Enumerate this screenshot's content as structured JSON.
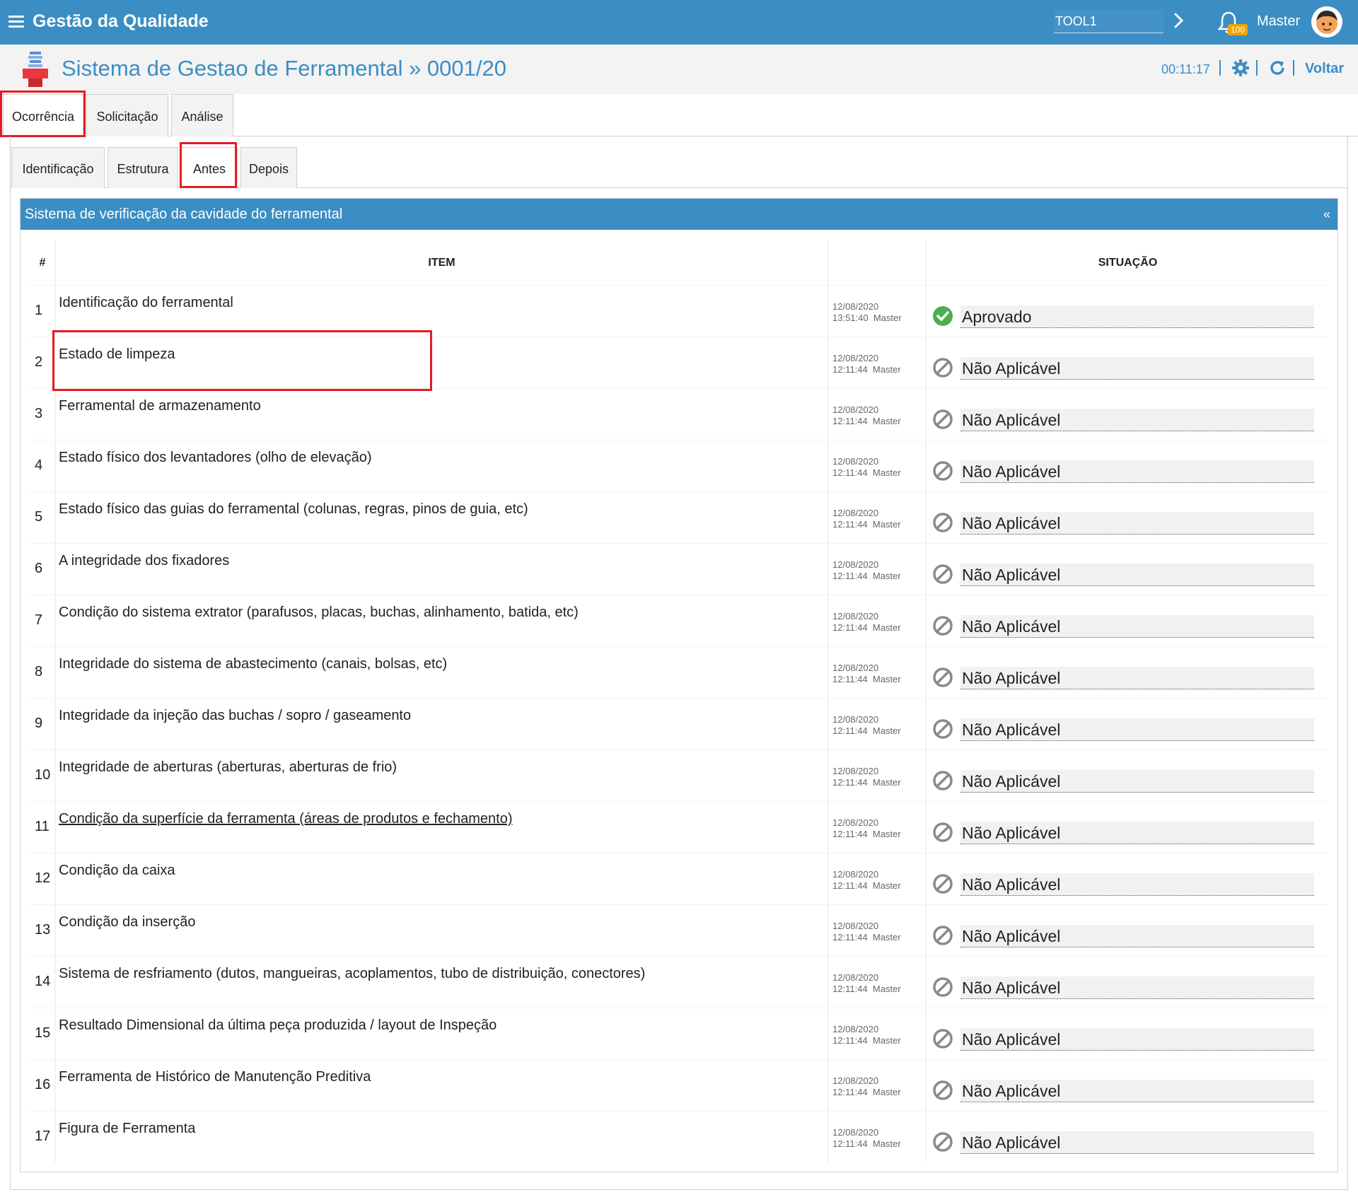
{
  "header": {
    "app_title": "Gestão da Qualidade",
    "tool_value": "TOOL1",
    "notification_count": "100",
    "user_name": "Master"
  },
  "subheader": {
    "page_title": "Sistema de Gestao de Ferramental » 0001/20",
    "timer": "00:11:17",
    "voltar": "Voltar"
  },
  "tabs": [
    "Ocorrência",
    "Solicitação",
    "Análise"
  ],
  "subtabs": [
    "Identificação",
    "Estrutura",
    "Antes",
    "Depois"
  ],
  "panel": {
    "title": "Sistema de verificação da cavidade do ferramental",
    "collapse_label": "«"
  },
  "table": {
    "headers": {
      "num": "#",
      "item": "ITEM",
      "situacao": "SITUAÇÃO"
    },
    "rows": [
      {
        "num": "1",
        "item": "Identificação do ferramental",
        "date": "12/08/2020",
        "time": "13:51:40",
        "user": "Master",
        "status": "Aprovado",
        "status_type": "approved"
      },
      {
        "num": "2",
        "item": "Estado de limpeza",
        "date": "12/08/2020",
        "time": "12:11:44",
        "user": "Master",
        "status": "Não Aplicável",
        "status_type": "na"
      },
      {
        "num": "3",
        "item": "Ferramental de armazenamento",
        "date": "12/08/2020",
        "time": "12:11:44",
        "user": "Master",
        "status": "Não Aplicável",
        "status_type": "na"
      },
      {
        "num": "4",
        "item": "Estado físico dos levantadores (olho de elevação)",
        "date": "12/08/2020",
        "time": "12:11:44",
        "user": "Master",
        "status": "Não Aplicável",
        "status_type": "na"
      },
      {
        "num": "5",
        "item": "Estado físico das guias do ferramental (colunas, regras, pinos de guia, etc)",
        "date": "12/08/2020",
        "time": "12:11:44",
        "user": "Master",
        "status": "Não Aplicável",
        "status_type": "na"
      },
      {
        "num": "6",
        "item": "A integridade dos fixadores",
        "date": "12/08/2020",
        "time": "12:11:44",
        "user": "Master",
        "status": "Não Aplicável",
        "status_type": "na"
      },
      {
        "num": "7",
        "item": "Condição do sistema extrator (parafusos, placas, buchas, alinhamento, batida, etc)",
        "date": "12/08/2020",
        "time": "12:11:44",
        "user": "Master",
        "status": "Não Aplicável",
        "status_type": "na"
      },
      {
        "num": "8",
        "item": "Integridade do sistema de abastecimento (canais, bolsas, etc)",
        "date": "12/08/2020",
        "time": "12:11:44",
        "user": "Master",
        "status": "Não Aplicável",
        "status_type": "na"
      },
      {
        "num": "9",
        "item": "Integridade da injeção das buchas / sopro / gaseamento",
        "date": "12/08/2020",
        "time": "12:11:44",
        "user": "Master",
        "status": "Não Aplicável",
        "status_type": "na"
      },
      {
        "num": "10",
        "item": "Integridade de aberturas (aberturas, aberturas de frio)",
        "date": "12/08/2020",
        "time": "12:11:44",
        "user": "Master",
        "status": "Não Aplicável",
        "status_type": "na"
      },
      {
        "num": "11",
        "item": "Condição da superfície da ferramenta (áreas de produtos e fechamento)",
        "date": "12/08/2020",
        "time": "12:11:44",
        "user": "Master",
        "status": "Não Aplicável",
        "status_type": "na",
        "underline": true
      },
      {
        "num": "12",
        "item": "Condição da caixa",
        "date": "12/08/2020",
        "time": "12:11:44",
        "user": "Master",
        "status": "Não Aplicável",
        "status_type": "na"
      },
      {
        "num": "13",
        "item": "Condição da inserção",
        "date": "12/08/2020",
        "time": "12:11:44",
        "user": "Master",
        "status": "Não Aplicável",
        "status_type": "na"
      },
      {
        "num": "14",
        "item": "Sistema de resfriamento (dutos, mangueiras, acoplamentos, tubo de distribuição, conectores)",
        "date": "12/08/2020",
        "time": "12:11:44",
        "user": "Master",
        "status": "Não Aplicável",
        "status_type": "na"
      },
      {
        "num": "15",
        "item": "Resultado Dimensional da última peça produzida / layout de Inspeção",
        "date": "12/08/2020",
        "time": "12:11:44",
        "user": "Master",
        "status": "Não Aplicável",
        "status_type": "na"
      },
      {
        "num": "16",
        "item": "Ferramenta de Histórico de Manutenção Preditiva",
        "date": "12/08/2020",
        "time": "12:11:44",
        "user": "Master",
        "status": "Não Aplicável",
        "status_type": "na"
      },
      {
        "num": "17",
        "item": "Figura de Ferramenta",
        "date": "12/08/2020",
        "time": "12:11:44",
        "user": "Master",
        "status": "Não Aplicável",
        "status_type": "na"
      }
    ]
  },
  "colors": {
    "brand_blue": "#3b8ec3",
    "highlight_red": "#e31c23",
    "approved_green": "#4caf50",
    "na_gray": "#8a8a8a"
  }
}
